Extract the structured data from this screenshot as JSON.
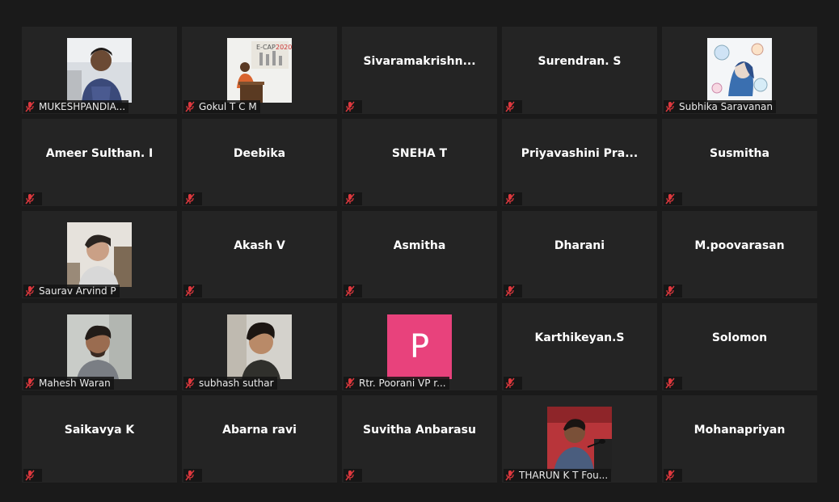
{
  "colors": {
    "muted_icon": "#e0383e",
    "tile_bg": "#242424",
    "page_bg": "#1a1a1a",
    "letter_avatar_bg": "#e8427c"
  },
  "participants": [
    {
      "name": "MUKESHPANDIA...",
      "has_video": true,
      "photo": "photo-man-1"
    },
    {
      "name": "Gokul T C M",
      "has_video": true,
      "photo": "photo-stage-speaker"
    },
    {
      "name": "Sivaramakrishn...",
      "has_video": false
    },
    {
      "name": "Surendran. S",
      "has_video": false
    },
    {
      "name": "Subhika Saravanan",
      "has_video": true,
      "photo": "photo-illustration"
    },
    {
      "name": "Ameer Sulthan. I",
      "has_video": false
    },
    {
      "name": "Deebika",
      "has_video": false
    },
    {
      "name": "SNEHA T",
      "has_video": false
    },
    {
      "name": "Priyavashini  Pra...",
      "has_video": false
    },
    {
      "name": "Susmitha",
      "has_video": false
    },
    {
      "name": "Saurav Arvind P",
      "has_video": true,
      "photo": "photo-man-2"
    },
    {
      "name": "Akash V",
      "has_video": false
    },
    {
      "name": "Asmitha",
      "has_video": false
    },
    {
      "name": "Dharani",
      "has_video": false
    },
    {
      "name": "M.poovarasan",
      "has_video": false
    },
    {
      "name": "Mahesh Waran",
      "has_video": true,
      "photo": "photo-man-3"
    },
    {
      "name": "subhash suthar",
      "has_video": true,
      "photo": "photo-man-4"
    },
    {
      "name": "Rtr. Poorani VP r...",
      "has_video": true,
      "letter": "P"
    },
    {
      "name": "Karthikeyan.S",
      "has_video": false
    },
    {
      "name": "Solomon",
      "has_video": false
    },
    {
      "name": "Saikavya K",
      "has_video": false
    },
    {
      "name": "Abarna ravi",
      "has_video": false
    },
    {
      "name": "Suvitha Anbarasu",
      "has_video": false
    },
    {
      "name": "THARUN K T Fou...",
      "has_video": true,
      "photo": "photo-man-5"
    },
    {
      "name": "Mohanapriyan",
      "has_video": false
    }
  ]
}
